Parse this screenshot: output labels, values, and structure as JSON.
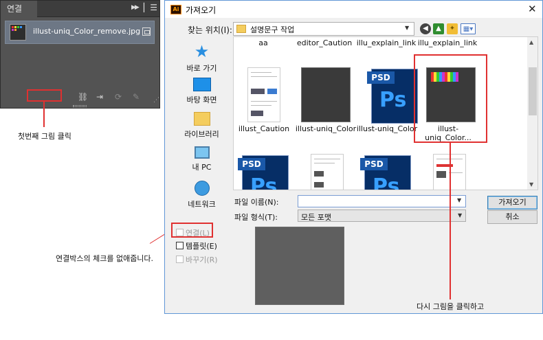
{
  "links_panel": {
    "tab": "연결",
    "collapse_icon": "double-chevron-right",
    "menu_icon": "panel-menu",
    "file_name": "illust-uniq_Color_remove.jpg"
  },
  "annotations": {
    "first_click": "첫번째 그림 클릭",
    "uncheck_link": "연결박스의 체크를 없애줍니다.",
    "click_again": "다시 그림을 클릭하고"
  },
  "dialog": {
    "title": "가져오기",
    "app_badge": "Ai",
    "lookin_label": "찾는 위치(I):",
    "lookin_value": "설명문구 작업",
    "places": [
      "바로 가기",
      "바탕 화면",
      "라이브러리",
      "내 PC",
      "네트워크"
    ],
    "files_row0": [
      "aa",
      "editor_Caution",
      "illu_explain_link",
      "illu_explain_link"
    ],
    "files_row1": [
      "illust_Caution",
      "illust-uniq_Color",
      "illust-uniq_Color",
      "illust-uniq_Color..."
    ],
    "psd_tag": "PSD",
    "psd_logo": "Ps",
    "filename_label": "파일 이름(N):",
    "filename_value": "",
    "filetype_label": "파일 형식(T):",
    "filetype_value": "모든 포맷",
    "open_button": "가져오기",
    "cancel_button": "취소",
    "options": {
      "link": "연결(L)",
      "template": "템플릿(E)",
      "replace": "바꾸기(R)"
    }
  },
  "colors": {
    "annotation_red": "#e03030",
    "panel_bg": "#535353",
    "selected_row": "#6d7785"
  }
}
